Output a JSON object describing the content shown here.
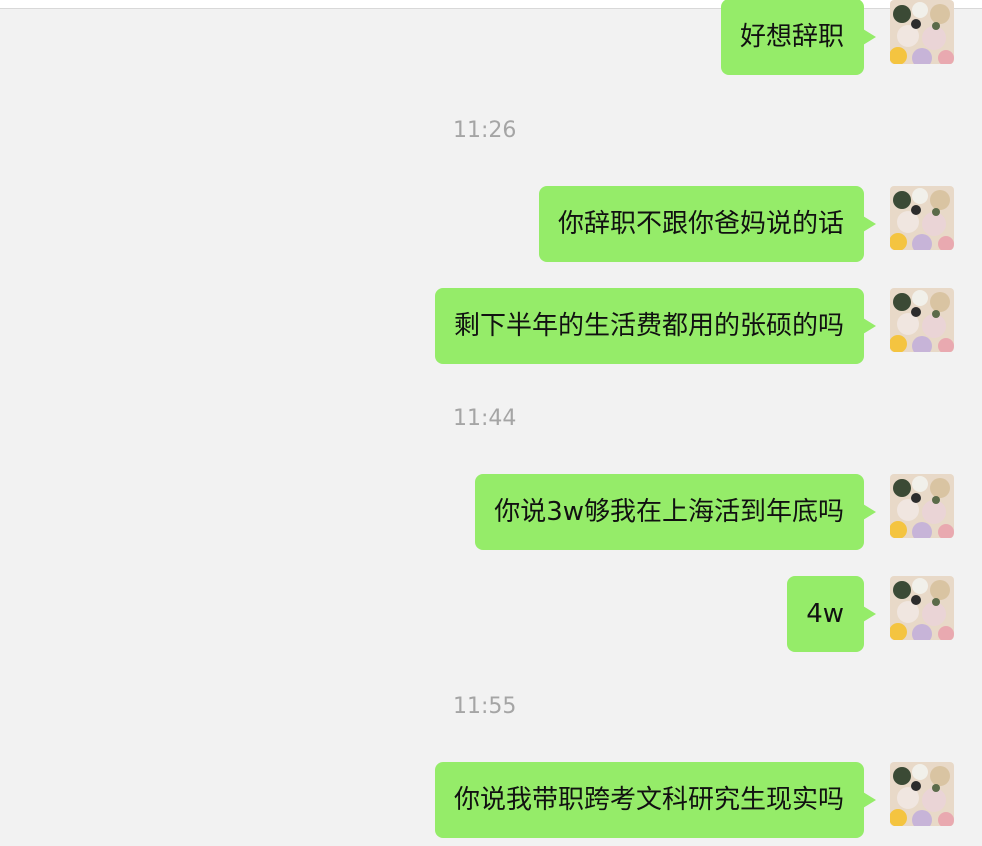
{
  "messages": [
    {
      "text": "好想辞职"
    },
    {
      "text": "你辞职不跟你爸妈说的话"
    },
    {
      "text": "剩下半年的生活费都用的张硕的吗"
    },
    {
      "text": "你说3w够我在上海活到年底吗"
    },
    {
      "text": "4w"
    },
    {
      "text": "你说我带职跨考文科研究生现实吗"
    }
  ],
  "timestamps": [
    "11:26",
    "11:44",
    "11:55"
  ],
  "colors": {
    "background": "#f2f2f2",
    "bubble": "#95ec69",
    "timestamp": "#a5a5a5"
  },
  "avatar_icon": "user-avatar-icon"
}
